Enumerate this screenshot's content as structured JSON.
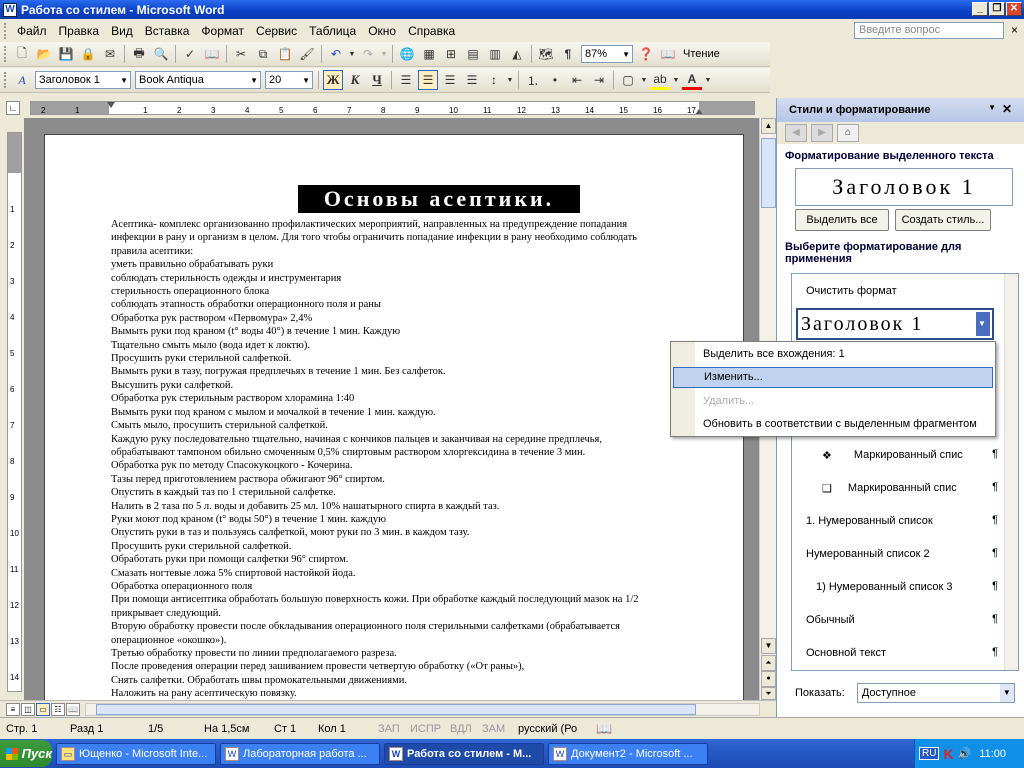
{
  "window": {
    "title": "Работа со стилем - Microsoft Word",
    "app_icon": "word-icon"
  },
  "menu": {
    "items": [
      "Файл",
      "Правка",
      "Вид",
      "Вставка",
      "Формат",
      "Сервис",
      "Таблица",
      "Окно",
      "Справка"
    ],
    "ask_placeholder": "Введите вопрос",
    "close_glyph": "×"
  },
  "toolbar_standard": {
    "zoom": "87%",
    "reading_label": "Чтение"
  },
  "toolbar_format": {
    "style": "Заголовок 1",
    "font": "Book Antiqua",
    "size": "20",
    "bold": "Ж",
    "italic": "К",
    "underline": "Ч"
  },
  "ruler": {
    "top_ticks": [
      "2",
      "1",
      "1",
      "2",
      "3",
      "4",
      "5",
      "6",
      "7",
      "8",
      "9",
      "10",
      "11",
      "12",
      "13",
      "14",
      "15",
      "16",
      "17"
    ],
    "left_ticks": [
      "1",
      "2",
      "3",
      "4",
      "5",
      "6",
      "7",
      "8",
      "9",
      "10",
      "11",
      "12",
      "13",
      "14",
      "15"
    ]
  },
  "document": {
    "title": "Основы асептики.",
    "lines": [
      "Асептика- комплекс организованно профилактических мероприятий, направленных на предупреждение попадания",
      "инфекции в рану и организм в целом. Для того чтобы ограничить попадание инфекции в рану необходимо соблюдать",
      "правила асептики:",
      "уметь правильно обрабатывать руки",
      "соблюдать стерильность одежды и инструментария",
      "стерильность операционного блока",
      "соблюдать этапность обработки операционного поля и раны",
      "Обработка рук  раствором «Первомура» 2,4%",
      "Вымыть руки под краном (t° воды 40°) в течение 1 мин. Каждую",
      "Тщательно смыть мыло (вода идет к локтю).",
      "Просушить руки стерильной салфеткой.",
      "Вымыть руки в тазу, погружая предплечьях в течение 1 мин. Без салфеток.",
      "Высушить руки салфеткой.",
      "Обработка рук стерильным раствором хлорамина 1:40",
      "Вымыть руки под краном с мылом и мочалкой в течение 1 мин. каждую.",
      "Смыть мыло, просушить стерильной салфеткой.",
      "Каждую руку последовательно тщательно, начиная с кончиков пальцев и заканчивая на середине предплечья,",
      "обрабатывают тампоном обильно смоченным 0,5% спиртовым раствором хлоргексидина в течение 3 мин.",
      "Обработка рук по методу  Спасокукоцкого - Кочерина.",
      "Тазы перед приготовлением раствора обжигают 96° спиртом.",
      "Опустить в каждый таз по 1 стерильной салфетке.",
      "Налить в 2 таза по 5 л. воды и добавить 25 мл. 10% нашатырного спирта в каждый таз.",
      "Руки моют под краном (t° воды 50°) в течение 1 мин. каждую",
      "Опустить руки в таз и пользуясь салфеткой, моют руки по 3 мин. в каждом тазу.",
      "Просушить руки стерильной салфеткой.",
      "Обработать руки при помощи салфетки 96° спиртом.",
      "Смазать ногтевые ложа 5% спиртовой настойкой йода.",
      "Обработка операционного поля",
      "При помощи антисептика обработать большую поверхность кожи. При обработке каждый последующий мазок на 1/2",
      "прикрывает следующий.",
      "Вторую обработку провести после обкладывания операционного поля стерильными салфетками (обрабатывается",
      "операционное «окошко»).",
      "Третью обработку провести по линии предполагаемого разреза.",
      "После проведения операции перед зашиванием провести четвертую обработку («От раны»),",
      "Снять салфетки. Обработать швы промокательными движениями.",
      "Наложить на рану асептическую повязку."
    ]
  },
  "statusbar": {
    "page": "Стр. 1",
    "section": "Разд 1",
    "pages": "1/5",
    "at": "На 1,5см",
    "line": "Ст 1",
    "col": "Кол 1",
    "rec": "ЗАП",
    "trk": "ИСПР",
    "ext": "ВДЛ",
    "ovr": "ЗАМ",
    "lang": "русский (Ро"
  },
  "taskpane": {
    "title": "Стили и форматирование",
    "section_current": "Форматирование выделенного текста",
    "current_style": "Заголовок 1",
    "select_all_btn": "Выделить все",
    "new_style_btn": "Создать стиль...",
    "section_apply": "Выберите форматирование для применения",
    "clear_format": "Очистить формат",
    "selected_style": "Заголовок 1",
    "styles": [
      {
        "label": "Маркированный спис",
        "bullet": "❖"
      },
      {
        "label": "Маркированный спис",
        "bullet": "❑"
      },
      {
        "label": "1.  Нумерованный список",
        "bullet": ""
      },
      {
        "label": "Нумерованный список 2",
        "bullet": ""
      },
      {
        "label": "1)  Нумерованный список 3",
        "bullet": ""
      },
      {
        "label": "Обычный",
        "bullet": ""
      },
      {
        "label": "Основной текст",
        "bullet": ""
      }
    ],
    "pilcrow": "¶",
    "show_label": "Показать:",
    "show_value": "Доступное"
  },
  "context_menu": {
    "items": [
      {
        "label": "Выделить все вхождения: 1",
        "state": "normal"
      },
      {
        "label": "Изменить...",
        "state": "highlighted"
      },
      {
        "label": "Удалить...",
        "state": "disabled"
      },
      {
        "label": "Обновить в соответствии с выделенным фрагментом",
        "state": "normal"
      }
    ]
  },
  "taskbar": {
    "start": "Пуск",
    "tasks": [
      {
        "label": "Ющенко - Microsoft Inte...",
        "active": false
      },
      {
        "label": "Лабораторная работа ...",
        "active": false
      },
      {
        "label": "Работа со стилем - М...",
        "active": true
      },
      {
        "label": "Документ2 - Microsoft ...",
        "active": false
      }
    ],
    "lang": "RU",
    "clock": "11:00"
  },
  "colors": {
    "title_blue": "#0a3fc4",
    "taskbar_blue": "#2456c2",
    "start_green": "#2f8a2f",
    "highlight": "#c1d2ee"
  }
}
